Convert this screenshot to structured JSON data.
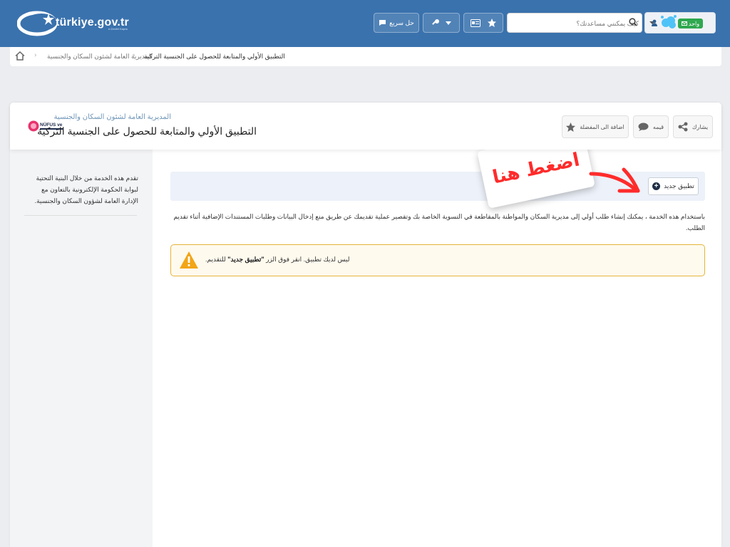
{
  "header": {
    "logo_text": "türkiye.gov.tr",
    "logo_subtext": "e-Devlet Kapısı",
    "quick_solution_label": "حل سريع",
    "search_placeholder": "كيف يمكنني مساعدتك؟",
    "login_label": "واحد",
    "login_badge": "e"
  },
  "breadcrumb": {
    "items": [
      "المديرية العامة لشئون السكان والجنسية",
      "التطبيق الأولي والمتابعة للحصول على الجنسية التركية"
    ]
  },
  "service": {
    "organization": "المديرية العامة لشئون السكان والجنسية",
    "title": "التطبيق الأولي والمتابعة للحصول على الجنسية التركية",
    "logo_text": "NÜFUS ve",
    "actions": {
      "add_to_favorites": "اضافة الى المفضلة",
      "rate": "قيمه",
      "share": "يشارك"
    }
  },
  "sidebar": {
    "text": "تقدم هذه الخدمة من خلال البنية التحتية لبوابة الحكومة الإلكترونية بالتعاون مع الإدارة العامة لشؤون السكان والجنسية."
  },
  "main": {
    "new_application_button": "تطبيق جديد",
    "description": "باستخدام هذه الخدمة ، يمكنك إنشاء طلب أولي إلى مديرية السكان والمواطنة بالمقاطعة في التسوية الخاصة بك وتقصير عملية تقديمك عن طريق منع إدخال البيانات وطلبات المستندات الإضافية أثناء تقديم الطلب.",
    "warning": {
      "before": "ليس لديك تطبيق. انقر فوق الزر ",
      "bold": "\"تطبيق جديد\"",
      "after": " للتقديم."
    }
  },
  "annotation": {
    "text": "اضغط هنا"
  },
  "colors": {
    "header_bg": "#3a72ad",
    "warning_border": "#e5b53a",
    "annotation_red": "#ff2b2b",
    "edevlet_green": "#2fa84f"
  }
}
